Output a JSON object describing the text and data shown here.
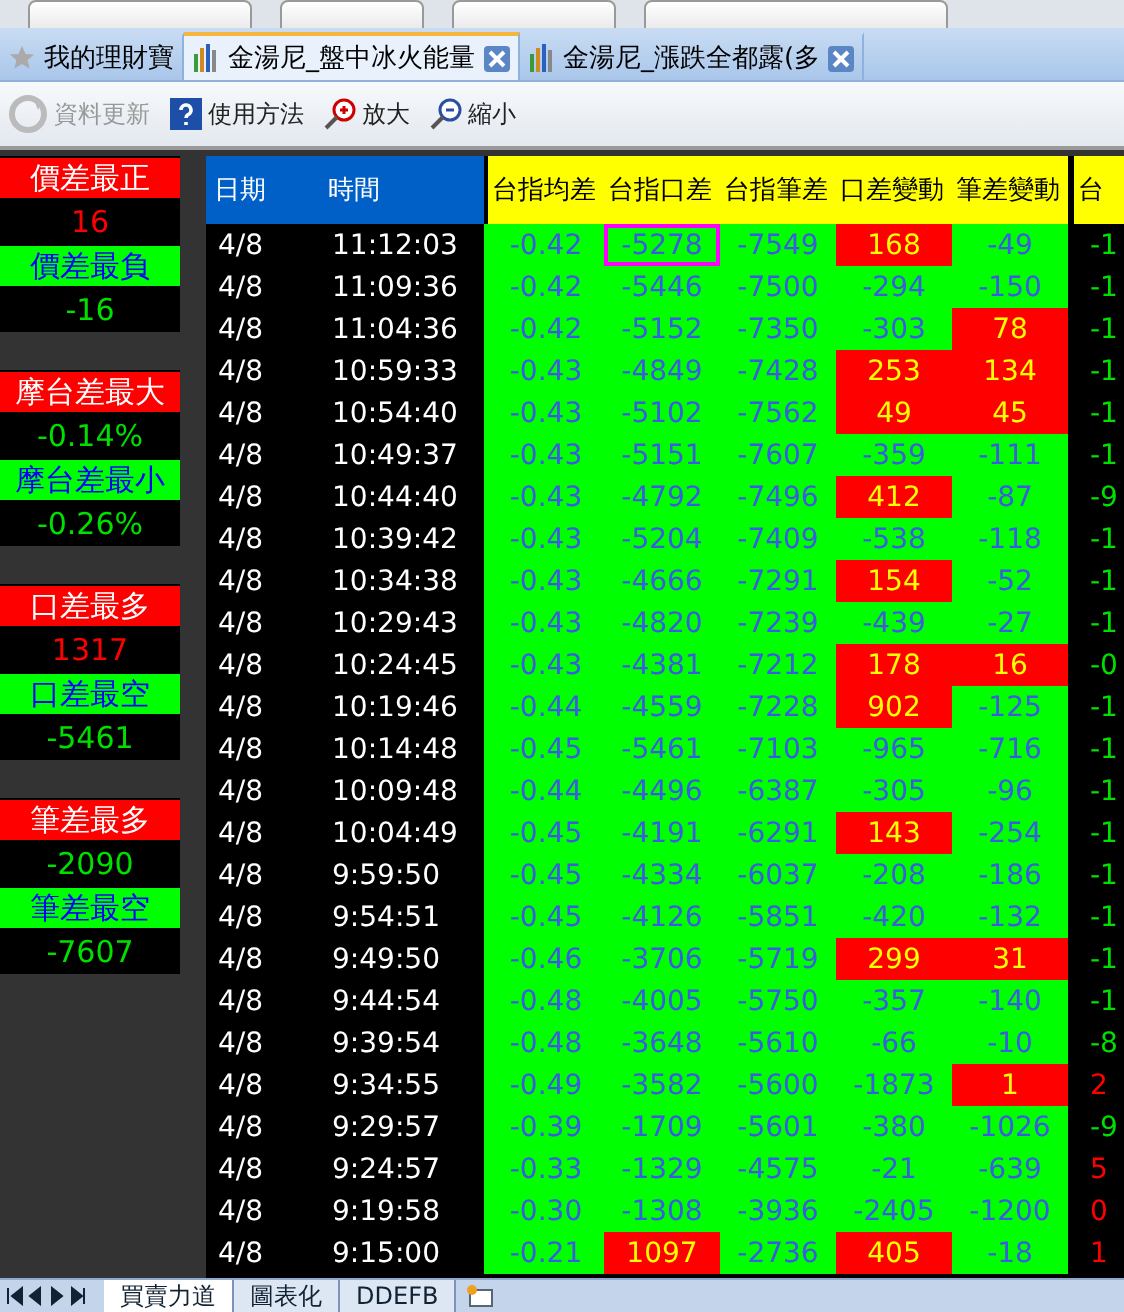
{
  "tabs": [
    {
      "label": "我的理財寶",
      "kind": "favorites",
      "selected": false
    },
    {
      "label": "金湯尼_盤中冰火能量",
      "kind": "report",
      "selected": true
    },
    {
      "label": "金湯尼_漲跌全都露(多",
      "kind": "report",
      "selected": false
    }
  ],
  "toolbar": [
    {
      "label": "資料更新",
      "kind": "refresh",
      "disabled": true
    },
    {
      "label": "使用方法",
      "kind": "help",
      "disabled": false
    },
    {
      "label": "放大",
      "kind": "zoomin",
      "disabled": false
    },
    {
      "label": "縮小",
      "kind": "zoomout",
      "disabled": false
    }
  ],
  "stats": [
    {
      "items": [
        {
          "kind": "max",
          "label": "價差最正",
          "value": "16",
          "value_red": true
        },
        {
          "kind": "min",
          "label": "價差最負",
          "value": "-16",
          "value_red": false
        }
      ]
    },
    {
      "items": [
        {
          "kind": "max",
          "label": "摩台差最大",
          "value": "-0.14%",
          "value_red": false
        },
        {
          "kind": "min",
          "label": "摩台差最小",
          "value": "-0.26%",
          "value_red": false
        }
      ]
    },
    {
      "items": [
        {
          "kind": "max",
          "label": "口差最多",
          "value": "1317",
          "value_red": true
        },
        {
          "kind": "min",
          "label": "口差最空",
          "value": "-5461",
          "value_red": false
        }
      ]
    },
    {
      "items": [
        {
          "kind": "max",
          "label": "筆差最多",
          "value": "-2090",
          "value_red": false
        },
        {
          "kind": "min",
          "label": "筆差最空",
          "value": "-7607",
          "value_red": false
        }
      ]
    }
  ],
  "table": {
    "columns": [
      "日期",
      "時間",
      "台指均差",
      "台指口差",
      "台指筆差",
      "口差變動",
      "筆差變動",
      "台"
    ],
    "rows": [
      {
        "cells": [
          "4/8",
          "11:12:03",
          "-0.42",
          "-5278",
          "-7549",
          "168",
          "-49",
          "-1"
        ],
        "red": [
          false,
          false,
          false,
          false,
          false,
          true,
          false,
          false
        ],
        "selected": [
          false,
          false,
          false,
          true,
          false,
          false,
          false,
          false
        ]
      },
      {
        "cells": [
          "4/8",
          "11:09:36",
          "-0.42",
          "-5446",
          "-7500",
          "-294",
          "-150",
          "-1"
        ],
        "red": [
          false,
          false,
          false,
          false,
          false,
          false,
          false,
          false
        ],
        "selected": [
          false,
          false,
          false,
          false,
          false,
          false,
          false,
          false
        ]
      },
      {
        "cells": [
          "4/8",
          "11:04:36",
          "-0.42",
          "-5152",
          "-7350",
          "-303",
          "78",
          "-1"
        ],
        "red": [
          false,
          false,
          false,
          false,
          false,
          false,
          true,
          false
        ],
        "selected": [
          false,
          false,
          false,
          false,
          false,
          false,
          false,
          false
        ]
      },
      {
        "cells": [
          "4/8",
          "10:59:33",
          "-0.43",
          "-4849",
          "-7428",
          "253",
          "134",
          "-1"
        ],
        "red": [
          false,
          false,
          false,
          false,
          false,
          true,
          true,
          false
        ],
        "selected": [
          false,
          false,
          false,
          false,
          false,
          false,
          false,
          false
        ]
      },
      {
        "cells": [
          "4/8",
          "10:54:40",
          "-0.43",
          "-5102",
          "-7562",
          "49",
          "45",
          "-1"
        ],
        "red": [
          false,
          false,
          false,
          false,
          false,
          true,
          true,
          false
        ],
        "selected": [
          false,
          false,
          false,
          false,
          false,
          false,
          false,
          false
        ]
      },
      {
        "cells": [
          "4/8",
          "10:49:37",
          "-0.43",
          "-5151",
          "-7607",
          "-359",
          "-111",
          "-1"
        ],
        "red": [
          false,
          false,
          false,
          false,
          false,
          false,
          false,
          false
        ],
        "selected": [
          false,
          false,
          false,
          false,
          false,
          false,
          false,
          false
        ]
      },
      {
        "cells": [
          "4/8",
          "10:44:40",
          "-0.43",
          "-4792",
          "-7496",
          "412",
          "-87",
          "-9"
        ],
        "red": [
          false,
          false,
          false,
          false,
          false,
          true,
          false,
          false
        ],
        "selected": [
          false,
          false,
          false,
          false,
          false,
          false,
          false,
          false
        ]
      },
      {
        "cells": [
          "4/8",
          "10:39:42",
          "-0.43",
          "-5204",
          "-7409",
          "-538",
          "-118",
          "-1"
        ],
        "red": [
          false,
          false,
          false,
          false,
          false,
          false,
          false,
          false
        ],
        "selected": [
          false,
          false,
          false,
          false,
          false,
          false,
          false,
          false
        ]
      },
      {
        "cells": [
          "4/8",
          "10:34:38",
          "-0.43",
          "-4666",
          "-7291",
          "154",
          "-52",
          "-1"
        ],
        "red": [
          false,
          false,
          false,
          false,
          false,
          true,
          false,
          false
        ],
        "selected": [
          false,
          false,
          false,
          false,
          false,
          false,
          false,
          false
        ]
      },
      {
        "cells": [
          "4/8",
          "10:29:43",
          "-0.43",
          "-4820",
          "-7239",
          "-439",
          "-27",
          "-1"
        ],
        "red": [
          false,
          false,
          false,
          false,
          false,
          false,
          false,
          false
        ],
        "selected": [
          false,
          false,
          false,
          false,
          false,
          false,
          false,
          false
        ]
      },
      {
        "cells": [
          "4/8",
          "10:24:45",
          "-0.43",
          "-4381",
          "-7212",
          "178",
          "16",
          "-0"
        ],
        "red": [
          false,
          false,
          false,
          false,
          false,
          true,
          true,
          false
        ],
        "selected": [
          false,
          false,
          false,
          false,
          false,
          false,
          false,
          false
        ]
      },
      {
        "cells": [
          "4/8",
          "10:19:46",
          "-0.44",
          "-4559",
          "-7228",
          "902",
          "-125",
          "-1"
        ],
        "red": [
          false,
          false,
          false,
          false,
          false,
          true,
          false,
          false
        ],
        "selected": [
          false,
          false,
          false,
          false,
          false,
          false,
          false,
          false
        ]
      },
      {
        "cells": [
          "4/8",
          "10:14:48",
          "-0.45",
          "-5461",
          "-7103",
          "-965",
          "-716",
          "-1"
        ],
        "red": [
          false,
          false,
          false,
          false,
          false,
          false,
          false,
          false
        ],
        "selected": [
          false,
          false,
          false,
          false,
          false,
          false,
          false,
          false
        ]
      },
      {
        "cells": [
          "4/8",
          "10:09:48",
          "-0.44",
          "-4496",
          "-6387",
          "-305",
          "-96",
          "-1"
        ],
        "red": [
          false,
          false,
          false,
          false,
          false,
          false,
          false,
          false
        ],
        "selected": [
          false,
          false,
          false,
          false,
          false,
          false,
          false,
          false
        ]
      },
      {
        "cells": [
          "4/8",
          "10:04:49",
          "-0.45",
          "-4191",
          "-6291",
          "143",
          "-254",
          "-1"
        ],
        "red": [
          false,
          false,
          false,
          false,
          false,
          true,
          false,
          false
        ],
        "selected": [
          false,
          false,
          false,
          false,
          false,
          false,
          false,
          false
        ]
      },
      {
        "cells": [
          "4/8",
          "9:59:50",
          "-0.45",
          "-4334",
          "-6037",
          "-208",
          "-186",
          "-1"
        ],
        "red": [
          false,
          false,
          false,
          false,
          false,
          false,
          false,
          false
        ],
        "selected": [
          false,
          false,
          false,
          false,
          false,
          false,
          false,
          false
        ]
      },
      {
        "cells": [
          "4/8",
          "9:54:51",
          "-0.45",
          "-4126",
          "-5851",
          "-420",
          "-132",
          "-1"
        ],
        "red": [
          false,
          false,
          false,
          false,
          false,
          false,
          false,
          false
        ],
        "selected": [
          false,
          false,
          false,
          false,
          false,
          false,
          false,
          false
        ]
      },
      {
        "cells": [
          "4/8",
          "9:49:50",
          "-0.46",
          "-3706",
          "-5719",
          "299",
          "31",
          "-1"
        ],
        "red": [
          false,
          false,
          false,
          false,
          false,
          true,
          true,
          false
        ],
        "selected": [
          false,
          false,
          false,
          false,
          false,
          false,
          false,
          false
        ]
      },
      {
        "cells": [
          "4/8",
          "9:44:54",
          "-0.48",
          "-4005",
          "-5750",
          "-357",
          "-140",
          "-1"
        ],
        "red": [
          false,
          false,
          false,
          false,
          false,
          false,
          false,
          false
        ],
        "selected": [
          false,
          false,
          false,
          false,
          false,
          false,
          false,
          false
        ]
      },
      {
        "cells": [
          "4/8",
          "9:39:54",
          "-0.48",
          "-3648",
          "-5610",
          "-66",
          "-10",
          "-8"
        ],
        "red": [
          false,
          false,
          false,
          false,
          false,
          false,
          false,
          false
        ],
        "selected": [
          false,
          false,
          false,
          false,
          false,
          false,
          false,
          false
        ]
      },
      {
        "cells": [
          "4/8",
          "9:34:55",
          "-0.49",
          "-3582",
          "-5600",
          "-1873",
          "1",
          "2"
        ],
        "red": [
          false,
          false,
          false,
          false,
          false,
          false,
          true,
          true
        ],
        "selected": [
          false,
          false,
          false,
          false,
          false,
          false,
          false,
          false
        ]
      },
      {
        "cells": [
          "4/8",
          "9:29:57",
          "-0.39",
          "-1709",
          "-5601",
          "-380",
          "-1026",
          "-9"
        ],
        "red": [
          false,
          false,
          false,
          false,
          false,
          false,
          false,
          false
        ],
        "selected": [
          false,
          false,
          false,
          false,
          false,
          false,
          false,
          false
        ]
      },
      {
        "cells": [
          "4/8",
          "9:24:57",
          "-0.33",
          "-1329",
          "-4575",
          "-21",
          "-639",
          "5"
        ],
        "red": [
          false,
          false,
          false,
          false,
          false,
          false,
          false,
          true
        ],
        "selected": [
          false,
          false,
          false,
          false,
          false,
          false,
          false,
          false
        ]
      },
      {
        "cells": [
          "4/8",
          "9:19:58",
          "-0.30",
          "-1308",
          "-3936",
          "-2405",
          "-1200",
          "0"
        ],
        "red": [
          false,
          false,
          false,
          false,
          false,
          false,
          false,
          true
        ],
        "selected": [
          false,
          false,
          false,
          false,
          false,
          false,
          false,
          false
        ]
      },
      {
        "cells": [
          "4/8",
          "9:15:00",
          "-0.21",
          "1097",
          "-2736",
          "405",
          "-18",
          "1"
        ],
        "red": [
          false,
          false,
          false,
          true,
          false,
          true,
          false,
          true
        ],
        "selected": [
          false,
          false,
          false,
          false,
          false,
          false,
          false,
          false
        ]
      }
    ]
  },
  "sheet_tabs": [
    {
      "label": "買賣力道",
      "selected": true
    },
    {
      "label": "圖表化",
      "selected": false
    },
    {
      "label": "DDEFB",
      "selected": false
    }
  ]
}
